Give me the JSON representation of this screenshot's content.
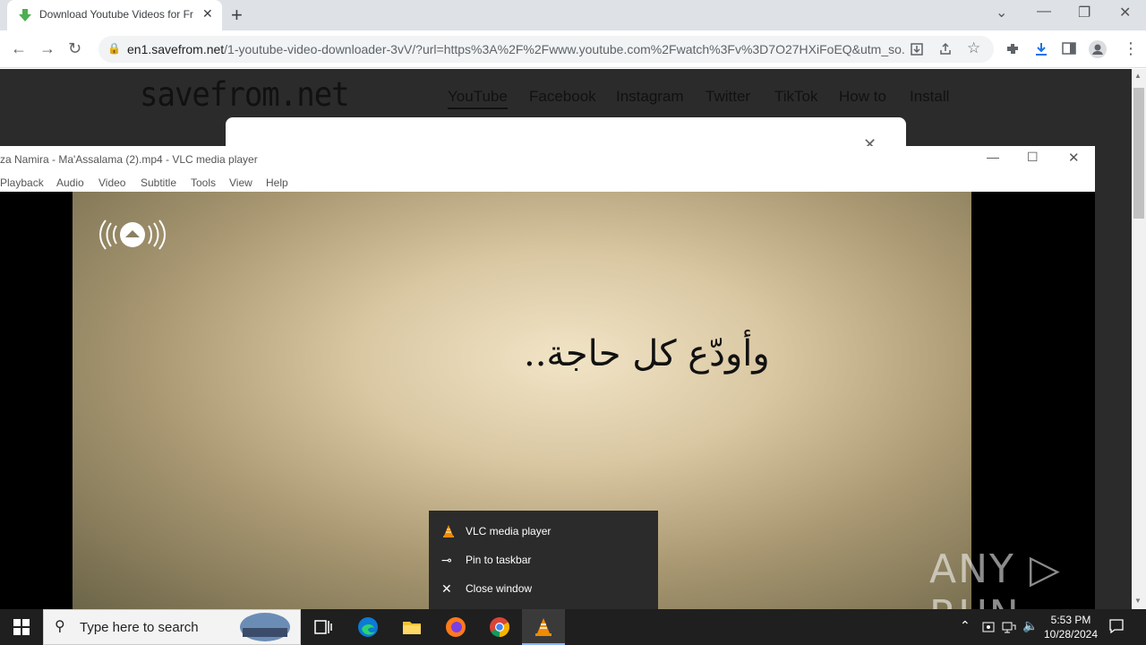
{
  "browser": {
    "tab_title": "Download Youtube Videos for Fr",
    "url_host": "en1.savefrom.net",
    "url_path": "/1-youtube-video-downloader-3vV/?url=https%3A%2F%2Fwww.youtube.com%2Fwatch%3Fv%3D7O27HXiFoEQ&utm_so..."
  },
  "site": {
    "logo": "savefrom.net",
    "nav": [
      "YouTube",
      "Facebook",
      "Instagram",
      "Twitter",
      "TikTok",
      "How to",
      "Install"
    ]
  },
  "vlc": {
    "title": "za Namira - Ma'Assalama  (2).mp4 - VLC media player",
    "menu": [
      "Playback",
      "Audio",
      "Video",
      "Subtitle",
      "Tools",
      "View",
      "Help"
    ],
    "video_caption": "وأودّع كل حاجة.."
  },
  "context_menu": {
    "items": [
      {
        "icon": "vlc-cone-icon",
        "label": "VLC media player"
      },
      {
        "icon": "pin-icon",
        "label": "Pin to taskbar"
      },
      {
        "icon": "close-icon",
        "label": "Close window"
      }
    ]
  },
  "watermark": "ANY ▷ RUN",
  "taskbar": {
    "search_placeholder": "Type here to search",
    "time": "5:53 PM",
    "date": "10/28/2024"
  }
}
